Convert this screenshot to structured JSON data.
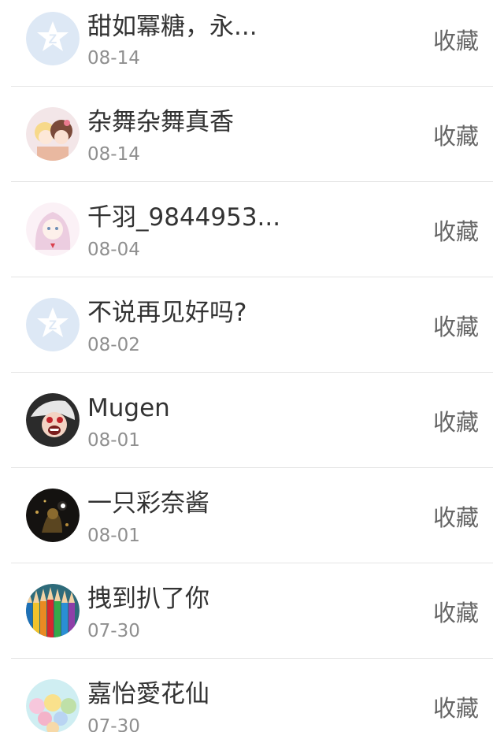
{
  "contacts": [
    {
      "name": "甜如冪糖，永...",
      "date": "08-14",
      "action": "收藏",
      "avatar": "default-qq-avatar-icon"
    },
    {
      "name": "杂舞杂舞真香",
      "date": "08-14",
      "action": "收藏",
      "avatar": "anime-pair-avatar"
    },
    {
      "name": "千羽_9844953...",
      "date": "08-04",
      "action": "收藏",
      "avatar": "anime-girl-avatar"
    },
    {
      "name": "不说再见好吗?",
      "date": "08-02",
      "action": "收藏",
      "avatar": "default-qq-avatar-icon"
    },
    {
      "name": "Mugen",
      "date": "08-01",
      "action": "收藏",
      "avatar": "screaming-character-avatar"
    },
    {
      "name": "一只彩奈酱",
      "date": "08-01",
      "action": "收藏",
      "avatar": "dark-figure-avatar"
    },
    {
      "name": "拽到扒了你",
      "date": "07-30",
      "action": "收藏",
      "avatar": "colored-pencils-avatar"
    },
    {
      "name": "嘉怡愛花仙",
      "date": "07-30",
      "action": "收藏",
      "avatar": "flower-fairies-avatar"
    }
  ],
  "colors": {
    "name_text": "#333333",
    "date_text": "#8f8f8f",
    "action_text": "#666666",
    "separator": "#e4e4e4",
    "default_avatar_bg": "#dde8f5",
    "default_avatar_fg": "#ffffff"
  }
}
